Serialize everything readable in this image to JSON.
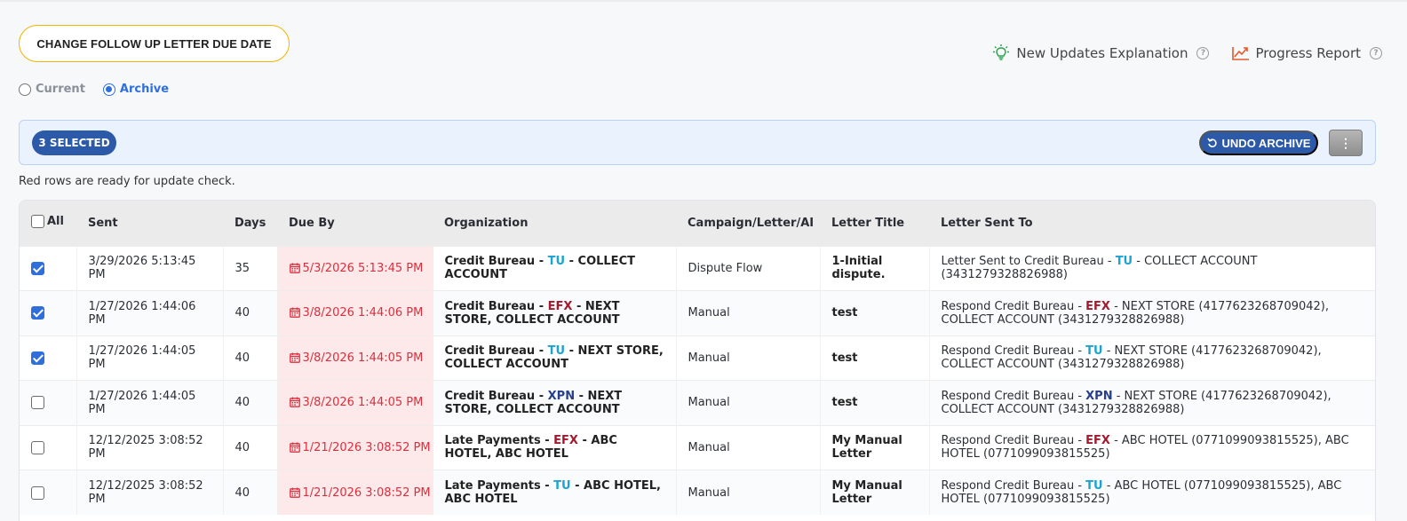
{
  "toolbar": {
    "follow_up_button": "CHANGE FOLLOW UP LETTER DUE DATE",
    "new_updates_link": "New Updates Explanation",
    "progress_report_link": "Progress Report"
  },
  "filter": {
    "current_label": "Current",
    "archive_label": "Archive",
    "selected": "Archive"
  },
  "selection": {
    "selected_label": "3 SELECTED",
    "undo_archive_label": "UNDO ARCHIVE",
    "kebab_icon": "kebab-menu-icon"
  },
  "note": "Red rows are ready for update check.",
  "table": {
    "headers": {
      "all": "All",
      "sent": "Sent",
      "days": "Days",
      "due_by": "Due By",
      "organization": "Organization",
      "campaign": "Campaign/Letter/AI",
      "letter_title": "Letter Title",
      "letter_sent_to": "Letter Sent To"
    },
    "rows": [
      {
        "checked": true,
        "sent": "3/29/2026 5:13:45 PM",
        "days": "35",
        "due_by": "5/3/2026 5:13:45 PM",
        "org_prefix": "Credit Bureau - ",
        "org_code": "TU",
        "org_code_type": "tu",
        "org_suffix": " - COLLECT ACCOUNT",
        "campaign": "Dispute Flow",
        "title": "1-Initial dispute.",
        "sent_to_prefix": "Letter Sent to Credit Bureau - ",
        "sent_to_code": "TU",
        "sent_to_suffix": " - COLLECT ACCOUNT (3431279328826988)"
      },
      {
        "checked": true,
        "sent": "1/27/2026 1:44:06 PM",
        "days": "40",
        "due_by": "3/8/2026 1:44:06 PM",
        "org_prefix": "Credit Bureau - ",
        "org_code": "EFX",
        "org_code_type": "efx",
        "org_suffix": " - NEXT STORE, COLLECT ACCOUNT",
        "campaign": "Manual",
        "title": "test",
        "sent_to_prefix": "Respond Credit Bureau - ",
        "sent_to_code": "EFX",
        "sent_to_suffix": " - NEXT STORE (4177623268709042), COLLECT ACCOUNT (3431279328826988)"
      },
      {
        "checked": true,
        "sent": "1/27/2026 1:44:05 PM",
        "days": "40",
        "due_by": "3/8/2026 1:44:05 PM",
        "org_prefix": "Credit Bureau - ",
        "org_code": "TU",
        "org_code_type": "tu",
        "org_suffix": " - NEXT STORE, COLLECT ACCOUNT",
        "campaign": "Manual",
        "title": "test",
        "sent_to_prefix": "Respond Credit Bureau - ",
        "sent_to_code": "TU",
        "sent_to_suffix": " - NEXT STORE (4177623268709042), COLLECT ACCOUNT (3431279328826988)"
      },
      {
        "checked": false,
        "sent": "1/27/2026 1:44:05 PM",
        "days": "40",
        "due_by": "3/8/2026 1:44:05 PM",
        "org_prefix": "Credit Bureau - ",
        "org_code": "XPN",
        "org_code_type": "xpn",
        "org_suffix": " - NEXT STORE, COLLECT ACCOUNT",
        "campaign": "Manual",
        "title": "test",
        "sent_to_prefix": "Respond Credit Bureau - ",
        "sent_to_code": "XPN",
        "sent_to_suffix": " - NEXT STORE (4177623268709042), COLLECT ACCOUNT (3431279328826988)"
      },
      {
        "checked": false,
        "sent": "12/12/2025 3:08:52 PM",
        "days": "40",
        "due_by": "1/21/2026 3:08:52 PM",
        "org_prefix": "Late Payments - ",
        "org_code": "EFX",
        "org_code_type": "efx",
        "org_suffix": " - ABC HOTEL, ABC HOTEL",
        "campaign": "Manual",
        "title": "My Manual Letter",
        "sent_to_prefix": "Respond Credit Bureau - ",
        "sent_to_code": "EFX",
        "sent_to_suffix": " - ABC HOTEL (0771099093815525), ABC HOTEL (0771099093815525)"
      },
      {
        "checked": false,
        "sent": "12/12/2025 3:08:52 PM",
        "days": "40",
        "due_by": "1/21/2026 3:08:52 PM",
        "org_prefix": "Late Payments - ",
        "org_code": "TU",
        "org_code_type": "tu",
        "org_suffix": " - ABC HOTEL, ABC HOTEL",
        "campaign": "Manual",
        "title": "My Manual Letter",
        "sent_to_prefix": "Respond Credit Bureau - ",
        "sent_to_code": "TU",
        "sent_to_suffix": " - ABC HOTEL (0771099093815525), ABC HOTEL (0771099093815525)"
      }
    ]
  },
  "colors": {
    "accent_blue": "#2c5aa8",
    "due_red": "#d9303d",
    "tu": "#1ba3d4",
    "efx": "#a31a2e",
    "xpn": "#263f8a"
  }
}
